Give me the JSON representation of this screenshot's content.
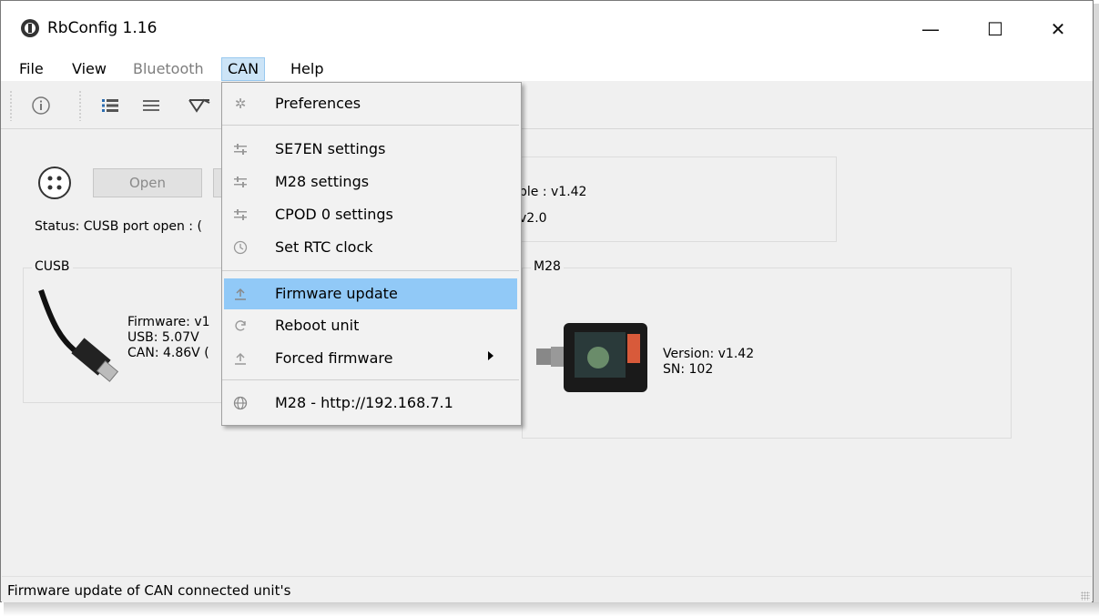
{
  "window": {
    "title": "RbConfig 1.16",
    "controls": {
      "minimize": "—",
      "maximize": "☐",
      "close": "✕"
    }
  },
  "menubar": {
    "items": [
      {
        "label": "File",
        "state": "normal"
      },
      {
        "label": "View",
        "state": "normal"
      },
      {
        "label": "Bluetooth",
        "state": "disabled"
      },
      {
        "label": "CAN",
        "state": "active"
      },
      {
        "label": "Help",
        "state": "normal"
      }
    ]
  },
  "toolbar": {
    "icons": [
      "info-icon",
      "list-detail-icon",
      "list-icon",
      "chart-icon"
    ]
  },
  "connection": {
    "open_label": "Open",
    "status": "Status: CUSB port open : ("
  },
  "cusb": {
    "group_label": "CUSB",
    "firmware": "Firmware: v1",
    "usb": "USB: 5.07V",
    "can": "CAN: 4.86V (",
    "icon": "usb-cable-icon"
  },
  "info_panel": {
    "line1": "ble : v1.42",
    "line2": "v2.0"
  },
  "m28": {
    "group_label": "M28",
    "version": "Version: v1.42",
    "sn": "SN: 102",
    "icon": "m28-device-icon"
  },
  "can_menu": {
    "items": [
      {
        "label": "Preferences",
        "icon": "gear-icon"
      },
      {
        "label": "SE7EN settings",
        "icon": "sliders-icon"
      },
      {
        "label": "M28 settings",
        "icon": "sliders-icon"
      },
      {
        "label": "CPOD 0 settings",
        "icon": "sliders-icon"
      },
      {
        "label": "Set RTC clock",
        "icon": "clock-icon"
      },
      {
        "label": "Firmware update",
        "icon": "upload-icon",
        "highlighted": true
      },
      {
        "label": "Reboot unit",
        "icon": "refresh-icon"
      },
      {
        "label": "Forced firmware",
        "icon": "upload-icon",
        "submenu": true
      },
      {
        "label": "M28 - http://192.168.7.1",
        "icon": "globe-icon"
      }
    ]
  },
  "statusbar": {
    "text": "Firmware update of CAN connected unit's"
  },
  "colors": {
    "highlight": "#91c9f7",
    "menu_active": "#cce4f7",
    "window_bg": "#f0f0f0"
  }
}
